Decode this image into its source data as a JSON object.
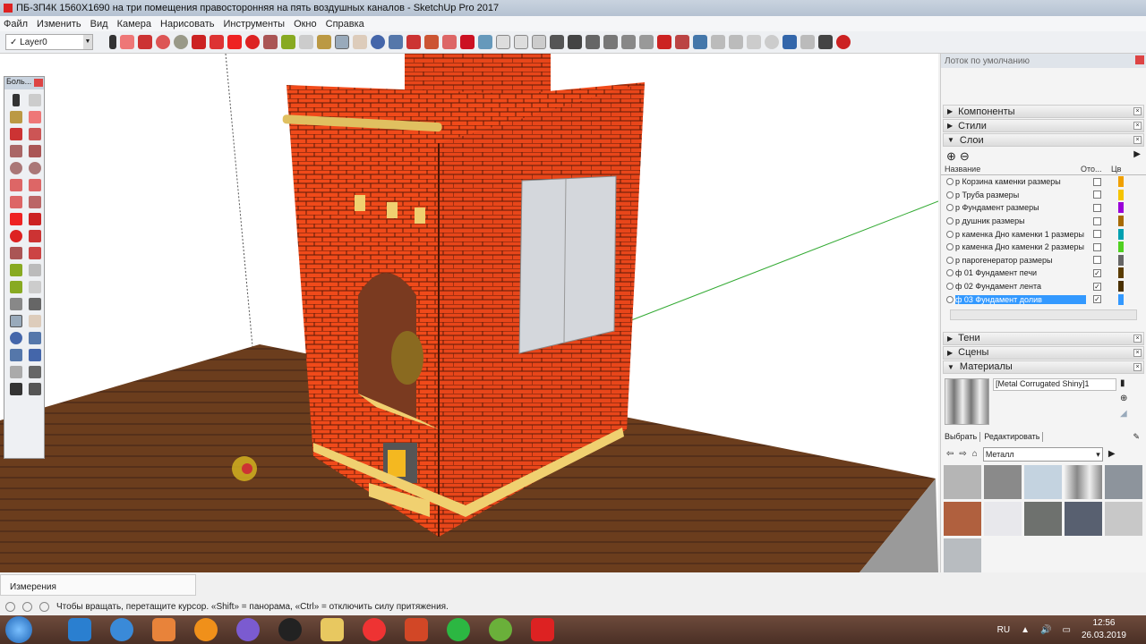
{
  "window": {
    "title": "ПБ-3П4К 1560Х1690  на три помещения правосторонняя на пять воздушных каналов - SketchUp Pro 2017"
  },
  "menu": [
    "Файл",
    "Изменить",
    "Вид",
    "Камера",
    "Нарисовать",
    "Инструменты",
    "Окно",
    "Справка"
  ],
  "toolbar": {
    "layer": "Layer0"
  },
  "palette": {
    "title": "Боль..."
  },
  "tray": {
    "title": "Лоток по умолчанию",
    "panels": {
      "components": "Компоненты",
      "styles": "Стили",
      "layers": "Слои",
      "shadows": "Тени",
      "scenes": "Сцены",
      "materials": "Материалы"
    },
    "layers": {
      "col_name": "Название",
      "col_visible": "Ото...",
      "col_color": "Цв",
      "rows": [
        {
          "name": "р Корзина каменки размеры",
          "visible": false,
          "color": "#f0a000"
        },
        {
          "name": "р Труба размеры",
          "visible": false,
          "color": "#f5c400"
        },
        {
          "name": "р Фундамент размеры",
          "visible": false,
          "color": "#9a00d8"
        },
        {
          "name": "р душник размеры",
          "visible": false,
          "color": "#a86a00"
        },
        {
          "name": "р каменка Дно каменки 1 размеры",
          "visible": false,
          "color": "#00a0b0"
        },
        {
          "name": "р каменка Дно каменки 2 размеры",
          "visible": false,
          "color": "#50d020"
        },
        {
          "name": "р парогенератор размеры",
          "visible": false,
          "color": "#666666"
        },
        {
          "name": "ф 01 Фундамент печи",
          "visible": true,
          "color": "#5a3c00"
        },
        {
          "name": "ф 02 Фундамент лента",
          "visible": true,
          "color": "#4a3000"
        },
        {
          "name": "ф 03 Фундамент долив",
          "visible": true,
          "color": "#3399ff"
        }
      ]
    },
    "materials": {
      "current": "[Metal Corrugated Shiny]1",
      "tab_select": "Выбрать",
      "tab_edit": "Редактировать",
      "collection": "Металл"
    }
  },
  "measurements_label": "Измерения",
  "status_text": "Чтобы вращать, перетащите курсор. «Shift» = панорама, «Ctrl» = отключить силу притяжения.",
  "taskbar": {
    "lang": "RU",
    "time": "12:56",
    "date": "26.03.2019"
  }
}
